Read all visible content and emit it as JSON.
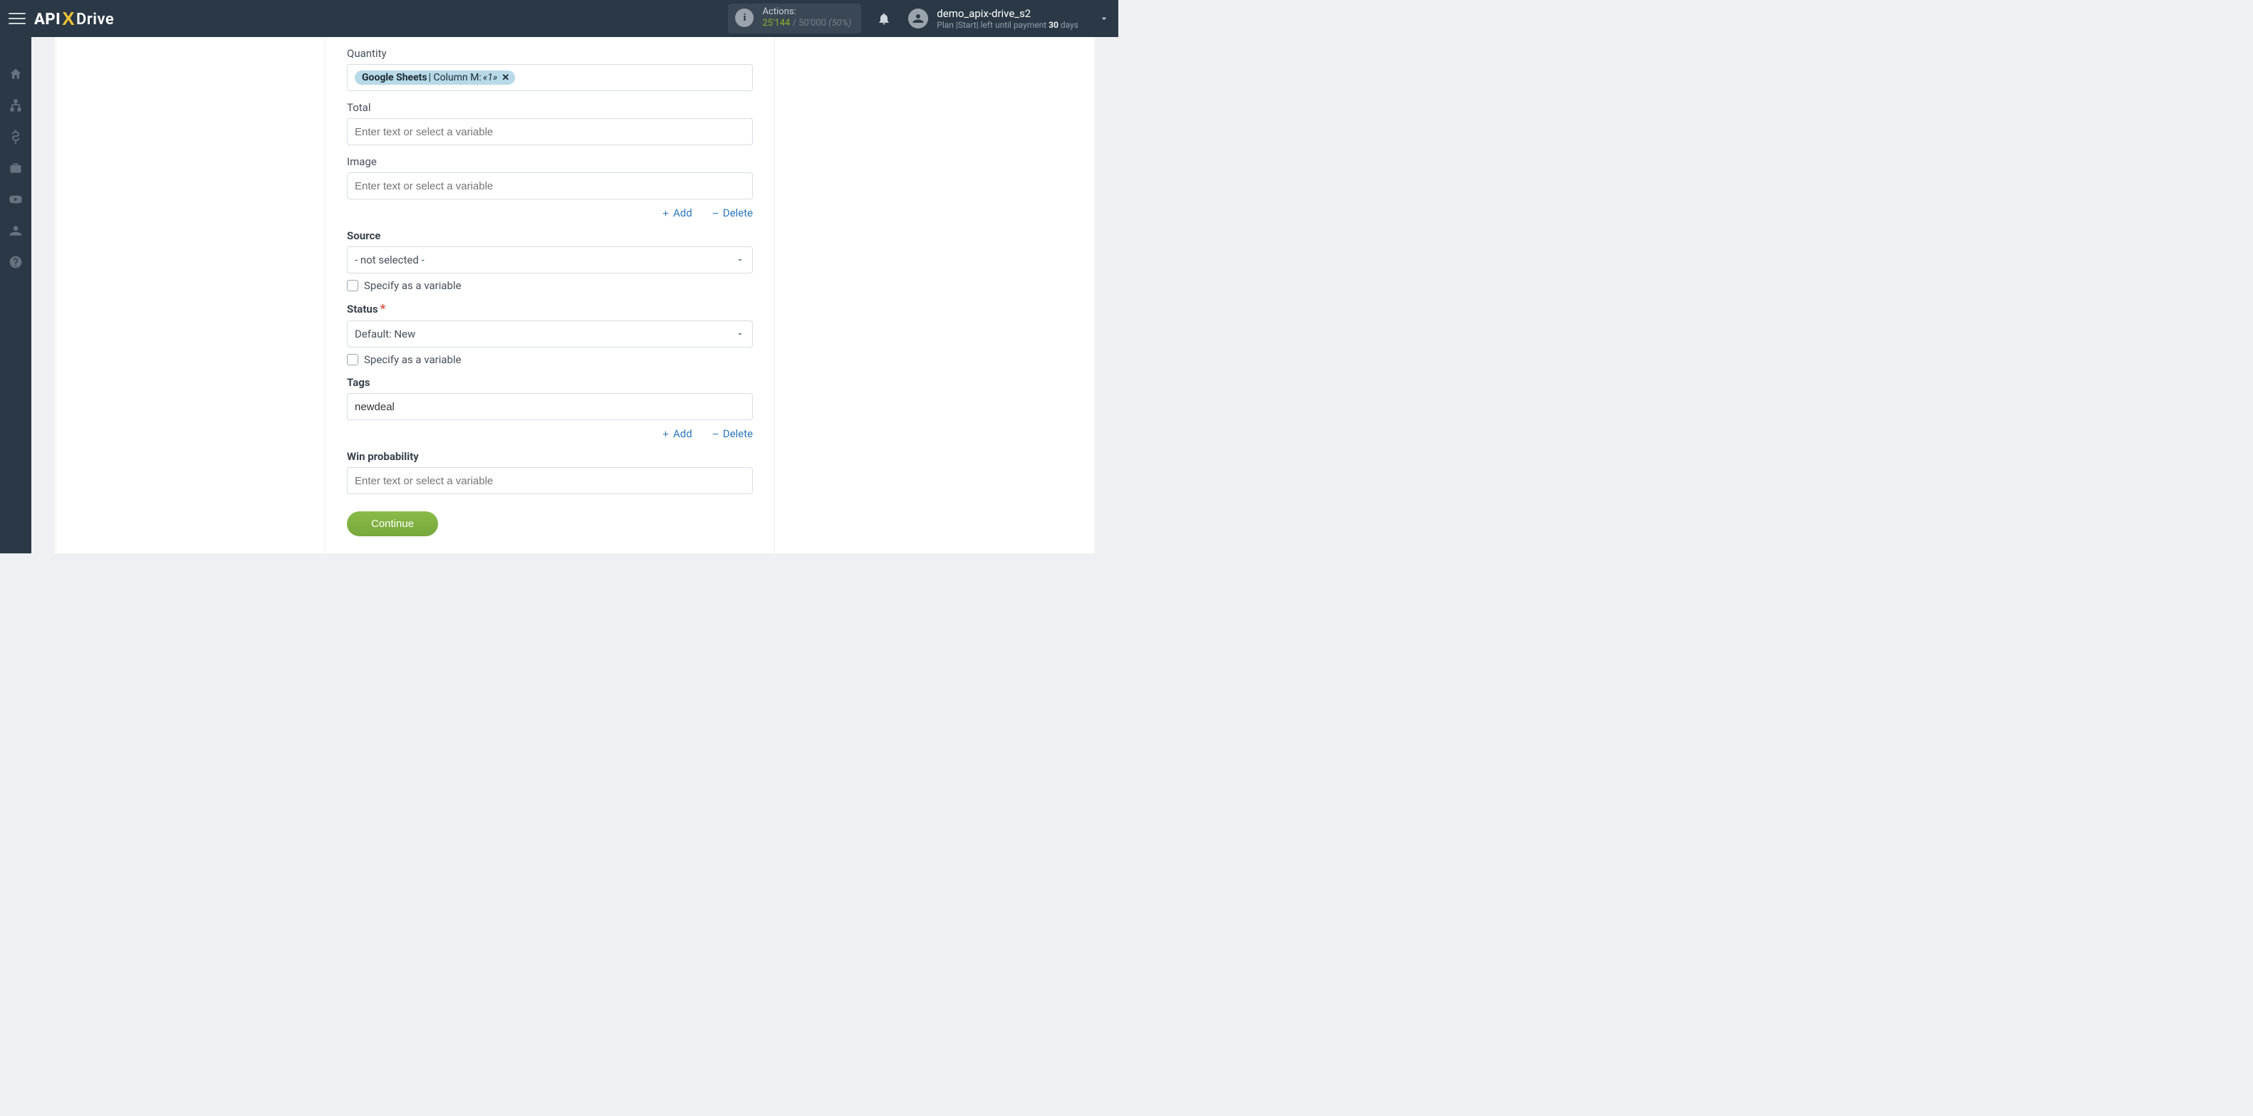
{
  "header": {
    "logo_api": "API",
    "logo_x": "X",
    "logo_drive": "Drive",
    "actions_label": "Actions:",
    "actions_used": "25'144",
    "actions_sep": " / ",
    "actions_total": "50'000",
    "actions_pct": "(50%)",
    "user_name": "demo_apix-drive_s2",
    "plan_prefix": "Plan |Start| left until payment ",
    "plan_days": "30",
    "plan_suffix": " days"
  },
  "sidebar": {
    "items": [
      "home-icon",
      "sitemap-icon",
      "dollar-icon",
      "briefcase-icon",
      "youtube-icon",
      "user-icon",
      "help-icon"
    ]
  },
  "form": {
    "quantity": {
      "label": "Quantity",
      "chip_src": "Google Sheets",
      "chip_col": " | Column M: ",
      "chip_val": "«1»"
    },
    "total": {
      "label": "Total",
      "placeholder": "Enter text or select a variable"
    },
    "image": {
      "label": "Image",
      "placeholder": "Enter text or select a variable"
    },
    "actions": {
      "add": "Add",
      "delete": "Delete"
    },
    "source": {
      "label": "Source",
      "value": "- not selected -",
      "specify": "Specify as a variable"
    },
    "status": {
      "label": "Status",
      "value": "Default: New",
      "specify": "Specify as a variable"
    },
    "tags": {
      "label": "Tags",
      "value": "newdeal"
    },
    "win": {
      "label": "Win probability",
      "placeholder": "Enter text or select a variable"
    },
    "continue": "Continue"
  }
}
